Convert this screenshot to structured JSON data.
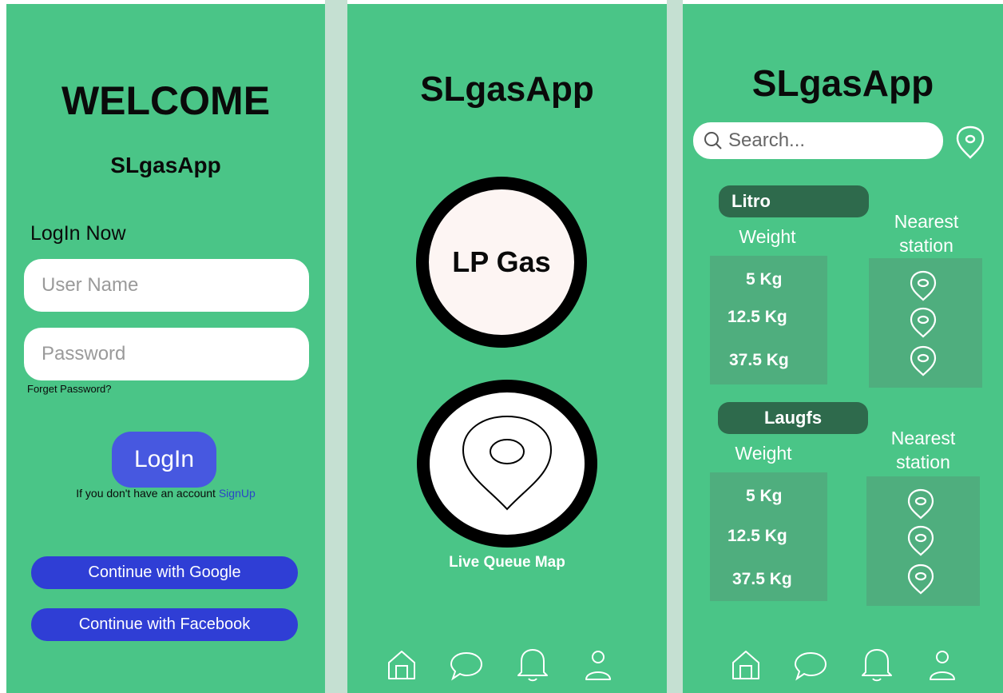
{
  "login_screen": {
    "welcome": "WELCOME",
    "app_name": "SLgasApp",
    "login_heading": "LogIn Now",
    "username_placeholder": "User Name",
    "password_placeholder": "Password",
    "forgot_password": "Forget Password?",
    "login_button": "LogIn",
    "no_account_text": "If you don't have an account",
    "signup_link": "SignUp",
    "google_button": "Continue with Google",
    "facebook_button": "Continue with Facebook"
  },
  "home_screen": {
    "title": "SLgasApp",
    "lp_gas_button": "LP Gas",
    "live_queue_map": "Live Queue Map",
    "nav_icons": [
      "home-icon",
      "chat-icon",
      "bell-icon",
      "user-icon"
    ]
  },
  "list_screen": {
    "title": "SLgasApp",
    "search_placeholder": "Search...",
    "sections": [
      {
        "brand": "Litro",
        "weight_label": "Weight",
        "nearest_label_1": "Nearest",
        "nearest_label_2": "station",
        "weights": [
          "5 Kg",
          "12.5 Kg",
          "37.5 Kg"
        ]
      },
      {
        "brand": "Laugfs",
        "weight_label": "Weight",
        "nearest_label_1": "Nearest",
        "nearest_label_2": "station",
        "weights": [
          "5 Kg",
          "12.5 Kg",
          "37.5 Kg"
        ]
      }
    ],
    "nav_icons": [
      "home-icon",
      "chat-icon",
      "bell-icon",
      "user-icon"
    ]
  },
  "colors": {
    "screen_bg": "#4ac587",
    "gap": "#c5e0d2",
    "primary_button": "#4758e0",
    "social_button": "#2f3ed5",
    "brand_pill": "#2e6a4c",
    "panel": "#4fae7e"
  }
}
